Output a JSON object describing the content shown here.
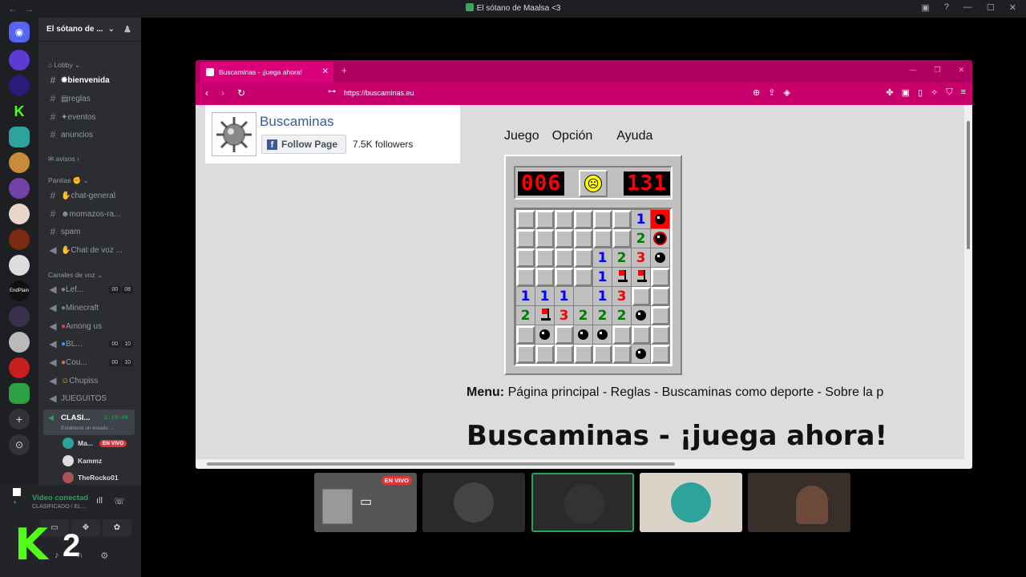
{
  "titlebar": {
    "title": "El sótano de Maalsa <3"
  },
  "server": {
    "name": "El sótano de ..."
  },
  "categories": {
    "lobby": "Lobby",
    "avisos": "avisos",
    "panitas": "Panitas",
    "voz": "Canales de voz"
  },
  "channels": [
    {
      "label": "bienvenida"
    },
    {
      "label": "reglas"
    },
    {
      "label": "eventos"
    },
    {
      "label": "anuncios"
    },
    {
      "label": "chat-general"
    },
    {
      "label": "momazos-ra..."
    },
    {
      "label": "spam"
    },
    {
      "label": "Chat de voz ..."
    }
  ],
  "voice_channels": [
    {
      "label": "Lef...",
      "c1": "00",
      "c2": "08"
    },
    {
      "label": "Minecraft"
    },
    {
      "label": "Among us"
    },
    {
      "label": "BL...",
      "c1": "00",
      "c2": "10"
    },
    {
      "label": "Cou...",
      "c1": "00",
      "c2": "10"
    },
    {
      "label": "Chupiss"
    },
    {
      "label": "JUEGUITOS"
    }
  ],
  "active_voice": {
    "name": "CLASI...",
    "time": "2:19:49",
    "status": "Establece un estado ..."
  },
  "voice_users": [
    {
      "name": "Ma...",
      "badge": "EN VIVO"
    },
    {
      "name": "Kammz"
    },
    {
      "name": "TheRocko01"
    }
  ],
  "user_panel": {
    "status": "Video conectad",
    "sub": "CLASIFICADO / EL..."
  },
  "browser": {
    "tab_title": "Buscaminas - ¡juega ahora!",
    "url": "https://buscaminas.eu"
  },
  "fb": {
    "title": "Buscaminas",
    "follow": "Follow Page",
    "followers": "7.5K followers"
  },
  "game_menu": [
    "Juego",
    "Opción",
    "Ayuda"
  ],
  "game": {
    "mines_left": "006",
    "timer": "131"
  },
  "grid": [
    [
      "c",
      "c",
      "c",
      "c",
      "c",
      "c",
      "1",
      "hit"
    ],
    [
      "c",
      "c",
      "c",
      "c",
      "c",
      "c",
      "2",
      "xmine"
    ],
    [
      "c",
      "c",
      "c",
      "c",
      "1",
      "2",
      "3",
      "mine"
    ],
    [
      "c",
      "c",
      "c",
      "c",
      "1",
      "flag",
      "flag",
      "c"
    ],
    [
      "1",
      "1",
      "1",
      "o",
      "1",
      "3",
      "c",
      "c"
    ],
    [
      "2",
      "flag",
      "3",
      "2",
      "2",
      "2",
      "mine",
      "c"
    ],
    [
      "c",
      "mine",
      "c",
      "mine",
      "mine",
      "c",
      "c",
      "c"
    ],
    [
      "c",
      "c",
      "c",
      "c",
      "c",
      "c",
      "mine",
      "c"
    ]
  ],
  "menu_line": {
    "label": "Menu:",
    "text": "Página principal - Reglas - Buscaminas como deporte - Sobre la p"
  },
  "page_title": "Buscaminas - ¡juega ahora!",
  "stream_badge": "EN VIVO"
}
